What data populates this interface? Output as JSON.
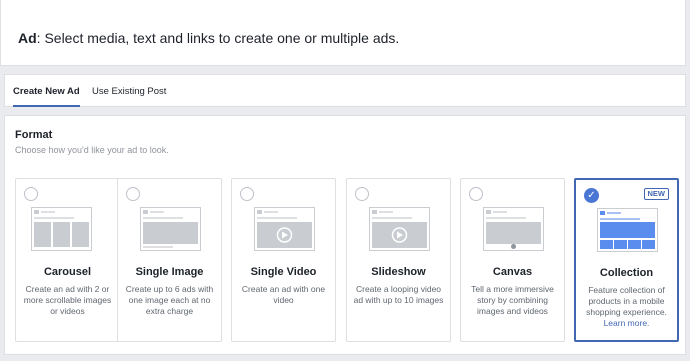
{
  "header": {
    "label_bold": "Ad",
    "label_rest": ": Select media, text and links to create one or multiple ads."
  },
  "tabs": [
    {
      "label": "Create New Ad",
      "active": true
    },
    {
      "label": "Use Existing Post",
      "active": false
    }
  ],
  "format": {
    "title": "Format",
    "subtitle": "Choose how you'd like your ad to look."
  },
  "cards": [
    {
      "title": "Carousel",
      "description": "Create an ad with 2 or more scrollable images or videos",
      "selected": false,
      "icon": "carousel-thumbnail-icon"
    },
    {
      "title": "Single Image",
      "description": "Create up to 6 ads with one image each at no extra charge",
      "selected": false,
      "icon": "single-image-thumbnail-icon"
    },
    {
      "title": "Single Video",
      "description": "Create an ad with one video",
      "selected": false,
      "icon": "single-video-thumbnail-icon"
    },
    {
      "title": "Slideshow",
      "description": "Create a looping video ad with up to 10 images",
      "selected": false,
      "icon": "slideshow-thumbnail-icon"
    },
    {
      "title": "Canvas",
      "description": "Tell a more immersive story by combining images and videos",
      "selected": false,
      "icon": "canvas-thumbnail-icon"
    },
    {
      "title": "Collection",
      "description": "Feature collection of products in a mobile shopping experience.",
      "link": "Learn more.",
      "badge": "NEW",
      "selected": true,
      "icon": "collection-thumbnail-icon"
    }
  ],
  "colors": {
    "accent": "#4267b2",
    "selected_check": "#4a76d4",
    "collection_blue": "#5b8def",
    "placeholder_gray": "#c9ccd1"
  }
}
